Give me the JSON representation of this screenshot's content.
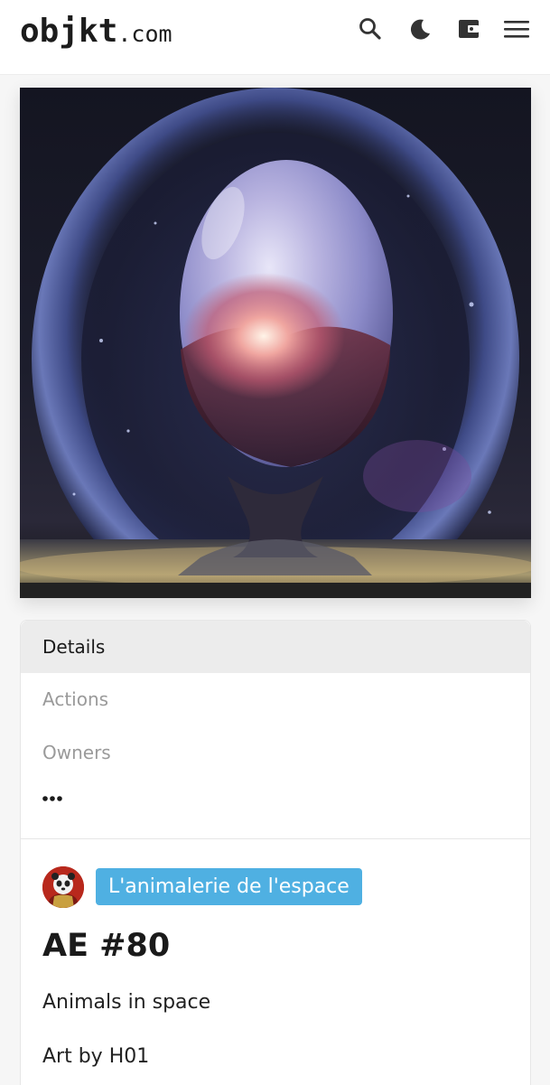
{
  "header": {
    "logo_main": "objkt",
    "logo_tld": ".com",
    "icons": [
      "search-icon",
      "moon-icon",
      "wallet-icon",
      "menu-icon"
    ]
  },
  "artwork": {
    "description_hidden": ""
  },
  "tabs": [
    {
      "label": "Details",
      "active": true
    },
    {
      "label": "Actions",
      "active": false
    },
    {
      "label": "Owners",
      "active": false
    }
  ],
  "tabs_more_icon": "more-dots-icon",
  "token": {
    "collection": "L'animalerie de l'espace",
    "title": "AE #80",
    "description_line1": "Animals in space",
    "description_line2": "Art by H01"
  },
  "colors": {
    "accent": "#4fb0e2",
    "active_tab_bg": "#ececec",
    "inactive_tab_text": "#9a9a9a"
  }
}
